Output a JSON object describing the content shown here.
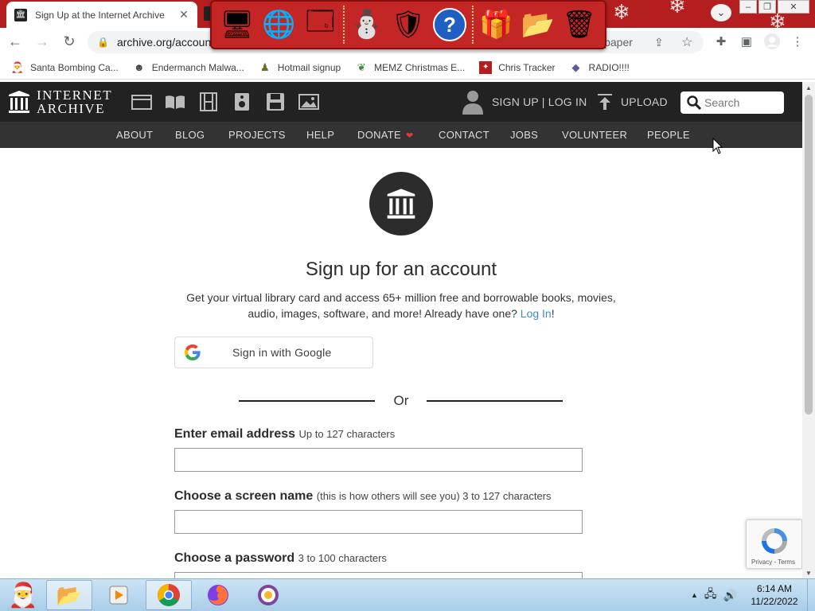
{
  "browser": {
    "tab": {
      "title": "Sign Up at the Internet Archive"
    },
    "url": "archive.org/account",
    "url_tail": "lpaper"
  },
  "bookmarks": [
    {
      "label": "Santa Bombing Ca...",
      "icon": "santa-icon"
    },
    {
      "label": "Endermanch Malwa...",
      "icon": "face-icon"
    },
    {
      "label": "Hotmail signup",
      "icon": "person-icon"
    },
    {
      "label": "MEMZ Christmas E...",
      "icon": "leaf-icon"
    },
    {
      "label": "Chris Tracker",
      "icon": "star-icon"
    },
    {
      "label": "RADIO!!!!",
      "icon": "radio-icon"
    }
  ],
  "xmas_bar": {
    "icons": [
      "computer-icon",
      "globe-icon",
      "control-panel-icon",
      "snowman-icon",
      "windows-update-icon",
      "help-icon",
      "gift-icon",
      "folder-icon",
      "recycle-bin-icon"
    ]
  },
  "ia": {
    "logo_line1": "INTERNET",
    "logo_line2": "ARCHIVE",
    "signup_login": "SIGN UP | LOG IN",
    "upload": "UPLOAD",
    "search_placeholder": "Search",
    "nav": [
      "ABOUT",
      "BLOG",
      "PROJECTS",
      "HELP",
      "DONATE",
      "CONTACT",
      "JOBS",
      "VOLUNTEER",
      "PEOPLE"
    ]
  },
  "signup": {
    "heading": "Sign up for an account",
    "lead_text": "Get your virtual library card and access 65+ million free and borrowable books, movies, audio, images, software, and more! Already have one?",
    "login_link": "Log In",
    "lead_end": "!",
    "google_button": "Sign in with Google",
    "or": "Or",
    "email_label": "Enter email address",
    "email_hint": "Up to 127 characters",
    "screen_name_label": "Choose a screen name",
    "screen_name_hint": "(this is how others will see you) 3 to 127 characters",
    "password_label": "Choose a password",
    "password_hint": "3 to 100 characters"
  },
  "recaptcha": {
    "label": "Privacy - Terms"
  },
  "taskbar": {
    "time": "6:14 AM",
    "date": "11/22/2022"
  },
  "colors": {
    "ia_header": "#222222",
    "ia_nav": "#333333",
    "link": "#428bca",
    "donate_heart": "#e0383e",
    "chrome_frame": "#b41e1e"
  }
}
